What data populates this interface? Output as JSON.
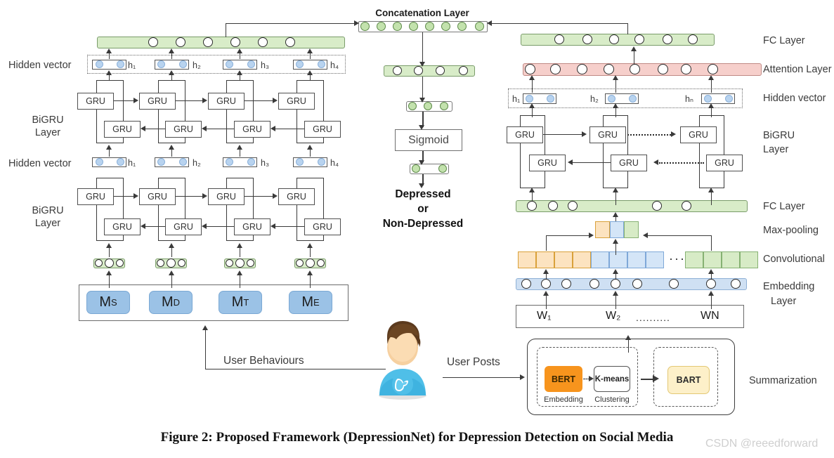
{
  "figure": {
    "caption": "Figure 2: Proposed Framework (DepressionNet) for Depression Detection on Social Media",
    "watermark": "CSDN @reeedforward"
  },
  "center": {
    "concatenation_label": "Concatenation Layer",
    "sigmoid_label": "Sigmoid",
    "verdict_line1": "Depressed",
    "verdict_line2": "or",
    "verdict_line3": "Non-Depressed"
  },
  "left_branch": {
    "labels": {
      "hidden_vector_top": "Hidden vector",
      "bigru_top_line1": "BiGRU",
      "bigru_top_line2": "Layer",
      "hidden_vector_bottom": "Hidden vector",
      "bigru_bottom_line1": "BiGRU",
      "bigru_bottom_line2": "Layer"
    },
    "gru_label": "GRU",
    "hidden_top": [
      "h₁",
      "h₂",
      "h₃",
      "h₄"
    ],
    "hidden_bottom": [
      "h₁",
      "h₂",
      "h₃",
      "h₄"
    ],
    "behaviour_chips": [
      {
        "base": "M",
        "sub": "S"
      },
      {
        "base": "M",
        "sub": "D"
      },
      {
        "base": "M",
        "sub": "T"
      },
      {
        "base": "M",
        "sub": "E"
      }
    ]
  },
  "right_branch": {
    "labels": {
      "fc_layer_top": "FC Layer",
      "attention_layer": "Attention Layer",
      "hidden_vector": "Hidden vector",
      "bigru_line1": "BiGRU",
      "bigru_line2": "Layer",
      "fc_layer_bottom": "FC Layer",
      "max_pooling": "Max-pooling",
      "convolutional": "Convolutional",
      "embedding_line1": "Embedding",
      "embedding_line2": "Layer",
      "summarization": "Summarization"
    },
    "gru_label": "GRU",
    "hidden": [
      "h₁",
      "h₂",
      "hₙ"
    ],
    "words": [
      "W₁",
      "W₂",
      "WN"
    ],
    "word_ellipsis": "..........",
    "conv_ellipsis": "·······"
  },
  "flow": {
    "user_behaviours": "User Behaviours",
    "user_posts": "User Posts",
    "avatar_name": "twitter-user-avatar"
  },
  "summarization": {
    "bert_label": "BERT",
    "bert_caption": "Embedding",
    "kmeans_label": "K-means",
    "kmeans_caption": "Clustering",
    "bart_label": "BART"
  },
  "colors": {
    "green_bar": "#d8ecc8",
    "red_bar": "#f6cfcb",
    "blue_bar": "#cfe0f3",
    "orange_conv": "#fce3c0",
    "blue_conv": "#d4e5f7",
    "green_conv": "#d7ebc6",
    "m_chip": "#9bc2e6",
    "bert": "#f7941d",
    "bart": "#fdf0c9",
    "label_text": "#3b3b3b"
  }
}
